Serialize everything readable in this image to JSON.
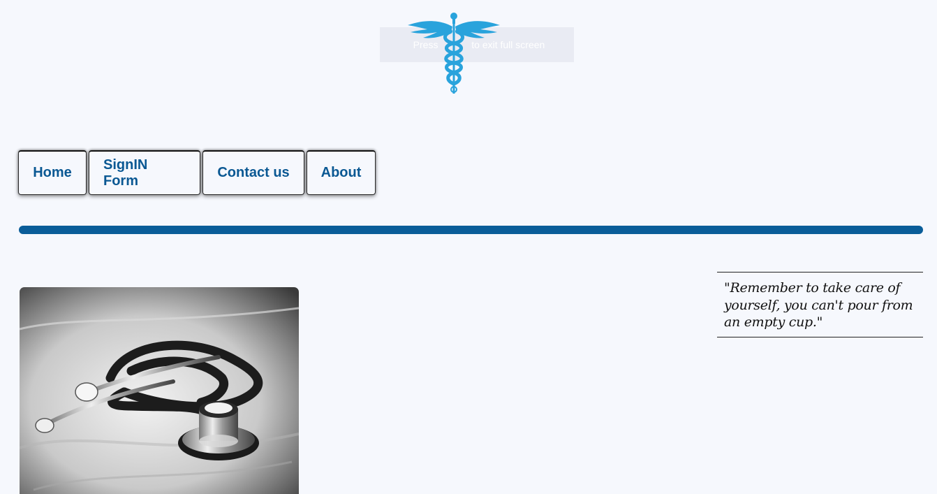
{
  "fullscreen_notice": {
    "prefix": "Press",
    "suffix": "to exit full screen"
  },
  "brand": {
    "logo_icon": "caduceus-icon",
    "logo_color": "#29a3dc"
  },
  "nav": {
    "items": [
      {
        "label": "Home"
      },
      {
        "label": "SignIN Form"
      },
      {
        "label": "Contact us"
      },
      {
        "label": "About"
      }
    ]
  },
  "hero": {
    "image": "stethoscope-photo"
  },
  "quote": {
    "text": "\"Remember to take care of yourself, you can't pour from an empty cup.\""
  },
  "colors": {
    "background": "#f6f8fd",
    "accent": "#0a5d99",
    "nav_text": "#0a5893"
  }
}
